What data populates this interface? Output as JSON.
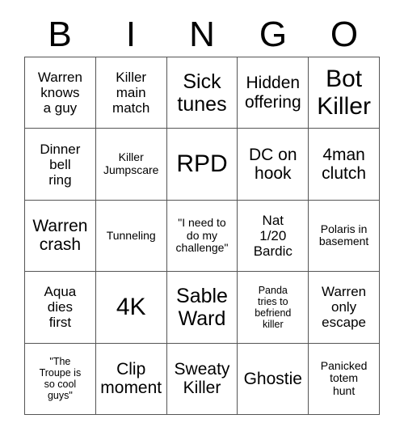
{
  "card": {
    "header_letters": [
      "B",
      "I",
      "N",
      "G",
      "O"
    ],
    "border_color": "#555555",
    "background_color": "#ffffff",
    "text_color": "#000000",
    "rows": 5,
    "columns": 5,
    "cells": [
      {
        "text": "Warren\nknows\na guy",
        "size": "sm"
      },
      {
        "text": "Killer\nmain\nmatch",
        "size": "sm"
      },
      {
        "text": "Sick\ntunes",
        "size": "lg"
      },
      {
        "text": "Hidden\noffering",
        "size": "md"
      },
      {
        "text": "Bot\nKiller",
        "size": "xl"
      },
      {
        "text": "Dinner\nbell\nring",
        "size": "sm"
      },
      {
        "text": "Killer\nJumpscare",
        "size": "xs"
      },
      {
        "text": "RPD",
        "size": "xl"
      },
      {
        "text": "DC on\nhook",
        "size": "md"
      },
      {
        "text": "4man\nclutch",
        "size": "md"
      },
      {
        "text": "Warren\ncrash",
        "size": "md"
      },
      {
        "text": "Tunneling",
        "size": "xs"
      },
      {
        "text": "\"I need to\ndo my\nchallenge\"",
        "size": "xs"
      },
      {
        "text": "Nat\n1/20\nBardic",
        "size": "sm"
      },
      {
        "text": "Polaris in\nbasement",
        "size": "xs"
      },
      {
        "text": "Aqua\ndies\nfirst",
        "size": "sm"
      },
      {
        "text": "4K",
        "size": "xl"
      },
      {
        "text": "Sable\nWard",
        "size": "lg"
      },
      {
        "text": "Panda\ntries to\nbefriend\nkiller",
        "size": "xxs"
      },
      {
        "text": "Warren\nonly\nescape",
        "size": "sm"
      },
      {
        "text": "\"The\nTroupe is\nso cool\nguys\"",
        "size": "xxs"
      },
      {
        "text": "Clip\nmoment",
        "size": "md"
      },
      {
        "text": "Sweaty\nKiller",
        "size": "md"
      },
      {
        "text": "Ghostie",
        "size": "md"
      },
      {
        "text": "Panicked\ntotem\nhunt",
        "size": "xs"
      }
    ]
  }
}
